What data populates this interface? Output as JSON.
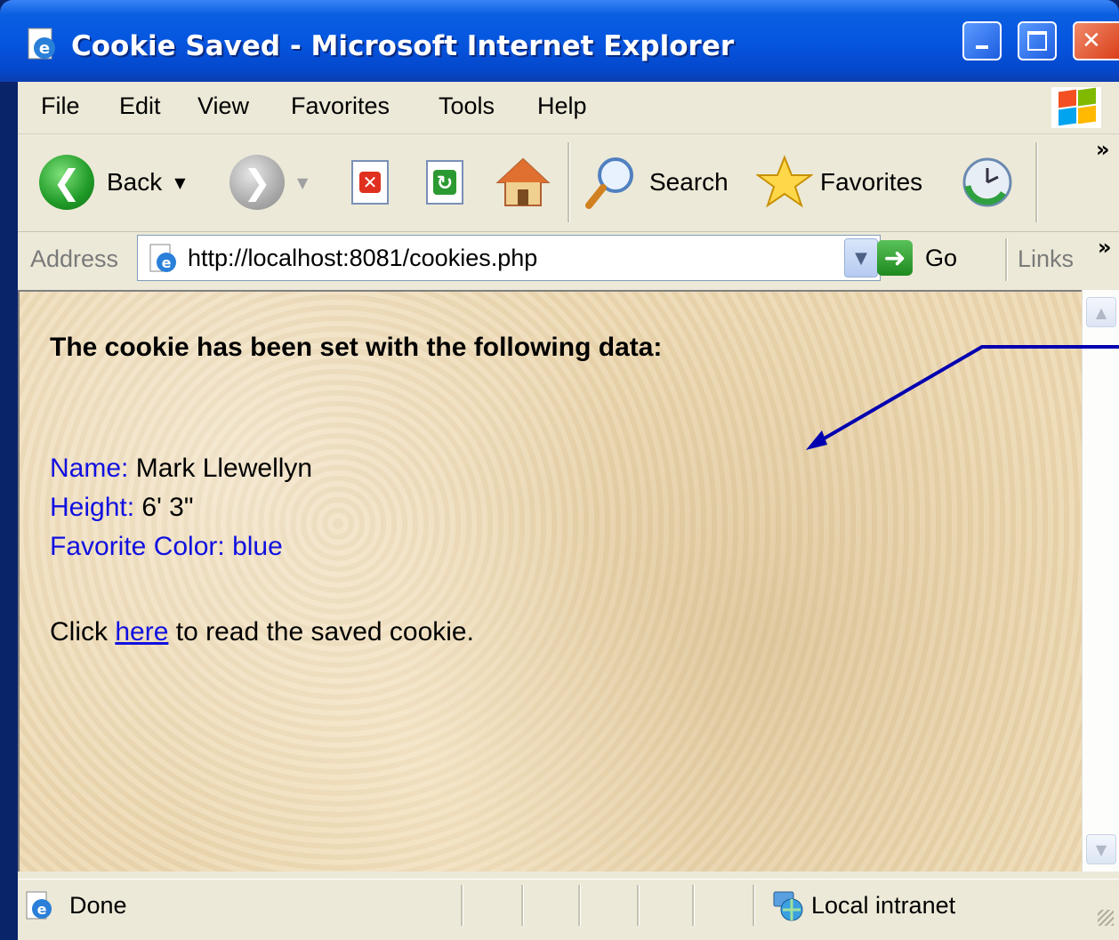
{
  "window": {
    "title": "Cookie Saved - Microsoft Internet Explorer",
    "icons": [
      "ie-page-icon",
      "minimize-icon",
      "maximize-icon",
      "close-icon"
    ]
  },
  "menu": {
    "file": "File",
    "edit": "Edit",
    "view": "View",
    "favorites": "Favorites",
    "tools": "Tools",
    "help": "Help"
  },
  "toolbar": {
    "back_label": "Back",
    "search_label": "Search",
    "favorites_label": "Favorites",
    "overflow": "»"
  },
  "address": {
    "label": "Address",
    "url": "http://localhost:8081/cookies.php",
    "go_label": "Go",
    "links_label": "Links",
    "overflow": "»"
  },
  "page": {
    "heading": "The cookie has been set with the following data:",
    "name_label": "Name:",
    "name_value": "Mark Llewellyn",
    "height_label": "Height:",
    "height_value": "6' 3\"",
    "color_label": "Favorite Color:",
    "color_value": "blue",
    "click_prefix": "Click",
    "click_link": "here",
    "click_suffix": "to read the saved cookie."
  },
  "status": {
    "text": "Done",
    "zone": "Local intranet"
  },
  "colors": {
    "titlebar": "#0656e0",
    "label_blue": "#1010e0",
    "content_bg": "#ecd9b4",
    "annotation_arrow": "#0000b0"
  }
}
